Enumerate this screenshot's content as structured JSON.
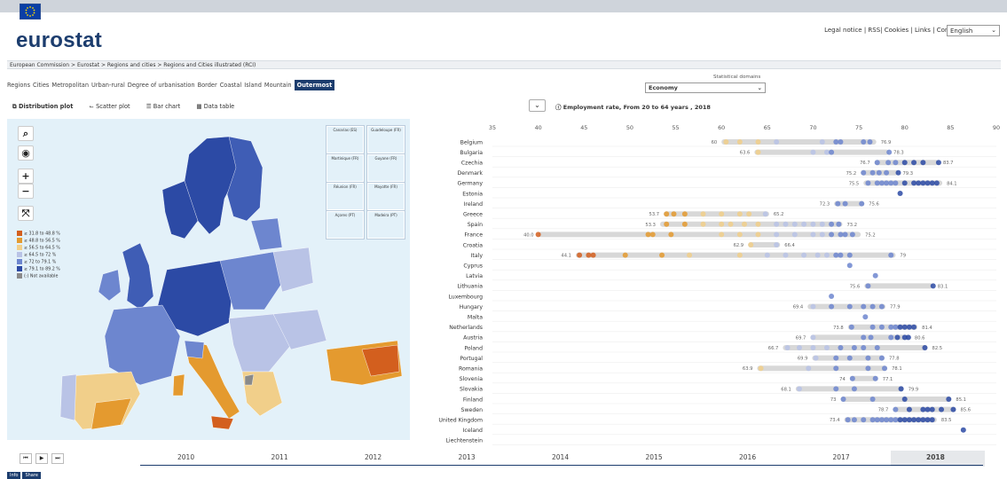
{
  "header": {
    "logo_text": "eurostat",
    "links": "Legal notice | RSS| Cookies | Links | Contact",
    "language": "English"
  },
  "breadcrumb": "European Commission > Eurostat > Regions and cities > Regions and Cities illustrated (RCI)",
  "tabs": [
    "Regions",
    "Cities",
    "Metropolitan",
    "Urban-rural",
    "Degree of urbanisation",
    "Border",
    "Coastal",
    "Island",
    "Mountain",
    "Outermost"
  ],
  "active_tab": "Outermost",
  "statistical_domains": {
    "label": "Statistical domains",
    "value": "Economy"
  },
  "views": [
    "Distribution plot",
    "Scatter plot",
    "Bar chart",
    "Data table"
  ],
  "active_view": "Distribution plot",
  "chart_title": "Employment rate, From 20 to 64 years , 2018",
  "map": {
    "legend": [
      {
        "label": "≥ 31.8 to 48.8 %",
        "color": "#d35f1e"
      },
      {
        "label": "≥ 48.8 to 56.5 %",
        "color": "#e49a2f"
      },
      {
        "label": "≥ 56.5 to 64.5 %",
        "color": "#f1cf8a"
      },
      {
        "label": "≥ 64.5 to 72 %",
        "color": "#b9c3e6"
      },
      {
        "label": "≥ 72 to 79.1 %",
        "color": "#6d86cf"
      },
      {
        "label": "≥ 79.1 to 89.2 %",
        "color": "#2c4aa5"
      },
      {
        "label": "(:) Not available",
        "color": "#8a8a8a"
      }
    ],
    "insets": [
      "Canarias (ES)",
      "Guadeloupe (FR)",
      "Martinique (FR)",
      "Guyane (FR)",
      "Réunion (FR)",
      "Mayotte (FR)",
      "Açores (PT)",
      "Madeira (PT)"
    ]
  },
  "chart_data": {
    "type": "scatter",
    "x_ticks": [
      35,
      40,
      45,
      50,
      55,
      60,
      65,
      70,
      75,
      80,
      85,
      90
    ],
    "xlim": [
      35,
      90
    ],
    "rows": [
      {
        "country": "Belgium",
        "min": 60,
        "max": 76.9,
        "min_label": "60",
        "max_label": "76.9",
        "points": [
          60.5,
          62,
          64,
          66,
          71,
          72.5,
          73,
          75.5,
          76.2
        ]
      },
      {
        "country": "Bulgaria",
        "min": 63.6,
        "max": 78.3,
        "min_label": "63.6",
        "max_label": "78.3",
        "points": [
          64,
          70,
          71.5,
          72,
          78.3
        ]
      },
      {
        "country": "Czechia",
        "min": 76.7,
        "max": 83.7,
        "min_label": "76.7",
        "max_label": "83.7",
        "points": [
          77,
          78.2,
          79,
          80,
          81,
          82,
          83.7
        ]
      },
      {
        "country": "Denmark",
        "min": 75.2,
        "max": 79.3,
        "min_label": "75.2",
        "max_label": "79.3",
        "points": [
          75.5,
          76.5,
          77.2,
          78,
          79.3
        ]
      },
      {
        "country": "Germany",
        "min": 75.5,
        "max": 84.1,
        "min_label": "75.5",
        "max_label": "84.1",
        "points": [
          76,
          77,
          77.5,
          78,
          78.5,
          79,
          80,
          81,
          81.5,
          82,
          82.5,
          83,
          83.5
        ]
      },
      {
        "country": "Estonia",
        "min": 79.5,
        "max": 79.5,
        "min_label": "",
        "max_label": "",
        "points": [
          79.5
        ]
      },
      {
        "country": "Ireland",
        "min": 72.3,
        "max": 75.6,
        "min_label": "72.3",
        "max_label": "75.6",
        "points": [
          72.7,
          73.5,
          75.3
        ]
      },
      {
        "country": "Greece",
        "min": 53.7,
        "max": 65.2,
        "min_label": "53.7",
        "max_label": "65.2",
        "points": [
          54,
          54.8,
          56,
          58,
          60,
          62,
          63,
          64.8
        ]
      },
      {
        "country": "Spain",
        "min": 53.3,
        "max": 73.2,
        "min_label": "53.3",
        "max_label": "73.2",
        "points": [
          54,
          56,
          58,
          60,
          61,
          62.5,
          64,
          66,
          67,
          68,
          69,
          70,
          71,
          72,
          72.8
        ]
      },
      {
        "country": "France",
        "min": 40,
        "max": 75.2,
        "min_label": "40.0",
        "max_label": "75.2",
        "points": [
          40,
          52,
          52.5,
          54.5,
          60,
          62,
          64,
          66,
          68,
          70,
          71,
          72,
          73,
          73.5,
          74.3
        ]
      },
      {
        "country": "Croatia",
        "min": 62.9,
        "max": 66.4,
        "min_label": "62.9",
        "max_label": "66.4",
        "points": [
          63.2,
          66
        ]
      },
      {
        "country": "Italy",
        "min": 44.1,
        "max": 79,
        "min_label": "44.1",
        "max_label": "79",
        "points": [
          44.5,
          45.5,
          46,
          49.5,
          53.5,
          56.5,
          62,
          65,
          67,
          69,
          70.5,
          71.5,
          72.5,
          73,
          74,
          78.5
        ]
      },
      {
        "country": "Cyprus",
        "min": 74,
        "max": 74,
        "min_label": "",
        "max_label": "",
        "points": [
          74
        ]
      },
      {
        "country": "Latvia",
        "min": 76.8,
        "max": 76.8,
        "min_label": "",
        "max_label": "",
        "points": [
          76.8
        ]
      },
      {
        "country": "Lithuania",
        "min": 75.6,
        "max": 83.1,
        "min_label": "75.6",
        "max_label": "83.1",
        "points": [
          76,
          83.1
        ]
      },
      {
        "country": "Luxembourg",
        "min": 72,
        "max": 72,
        "min_label": "",
        "max_label": "",
        "points": [
          72
        ]
      },
      {
        "country": "Hungary",
        "min": 69.4,
        "max": 77.9,
        "min_label": "69.4",
        "max_label": "77.9",
        "points": [
          70,
          72,
          74,
          75.5,
          76.5,
          77.5
        ]
      },
      {
        "country": "Malta",
        "min": 75.7,
        "max": 75.7,
        "min_label": "",
        "max_label": "",
        "points": [
          75.7
        ]
      },
      {
        "country": "Netherlands",
        "min": 73.8,
        "max": 81.4,
        "min_label": "73.8",
        "max_label": "81.4",
        "points": [
          74.2,
          76.5,
          77.5,
          78.5,
          79,
          79.5,
          80,
          80.5,
          81
        ]
      },
      {
        "country": "Austria",
        "min": 69.7,
        "max": 80.6,
        "min_label": "69.7",
        "max_label": "80.6",
        "points": [
          70,
          75.5,
          76.3,
          78.5,
          79.2,
          80,
          80.4
        ]
      },
      {
        "country": "Poland",
        "min": 66.7,
        "max": 82.5,
        "min_label": "66.7",
        "max_label": "82.5",
        "points": [
          67.2,
          68.5,
          70,
          71.5,
          73,
          74.5,
          75.5,
          77,
          82.2
        ]
      },
      {
        "country": "Portugal",
        "min": 69.9,
        "max": 77.8,
        "min_label": "69.9",
        "max_label": "77.8",
        "points": [
          70.3,
          72.5,
          74,
          76,
          77.5
        ]
      },
      {
        "country": "Romania",
        "min": 63.9,
        "max": 78.1,
        "min_label": "63.9",
        "max_label": "78.1",
        "points": [
          64.3,
          69.5,
          72.5,
          76,
          77.8
        ]
      },
      {
        "country": "Slovenia",
        "min": 74,
        "max": 77.1,
        "min_label": "74",
        "max_label": "77.1",
        "points": [
          74.3,
          76.8
        ]
      },
      {
        "country": "Slovakia",
        "min": 68.1,
        "max": 79.9,
        "min_label": "68.1",
        "max_label": "79.9",
        "points": [
          68.5,
          72.5,
          74.5,
          79.6
        ]
      },
      {
        "country": "Finland",
        "min": 73,
        "max": 85.1,
        "min_label": "73",
        "max_label": "85.1",
        "points": [
          73.3,
          76.5,
          80,
          84.8
        ]
      },
      {
        "country": "Sweden",
        "min": 78.7,
        "max": 85.6,
        "min_label": "78.7",
        "max_label": "85.6",
        "points": [
          79,
          80.5,
          82,
          82.5,
          83,
          84,
          85.3
        ]
      },
      {
        "country": "United Kingdom",
        "min": 73.4,
        "max": 83.5,
        "min_label": "73.4",
        "max_label": "83.5",
        "points": [
          73.8,
          74.5,
          75.5,
          76.5,
          77,
          77.5,
          78,
          78.5,
          79,
          79.5,
          80,
          80.5,
          81,
          81.5,
          82,
          82.5,
          83
        ]
      },
      {
        "country": "Iceland",
        "min": 86.4,
        "max": 86.4,
        "min_label": "",
        "max_label": "",
        "points": [
          86.4
        ]
      },
      {
        "country": "Liechtenstein",
        "min": 0,
        "max": 0,
        "min_label": "",
        "max_label": "",
        "points": []
      }
    ]
  },
  "timeline": {
    "years": [
      "2010",
      "2011",
      "2012",
      "2013",
      "2014",
      "2015",
      "2016",
      "2017",
      "2018"
    ],
    "selected": "2018"
  },
  "bottom_buttons": [
    "Info",
    "Share"
  ]
}
